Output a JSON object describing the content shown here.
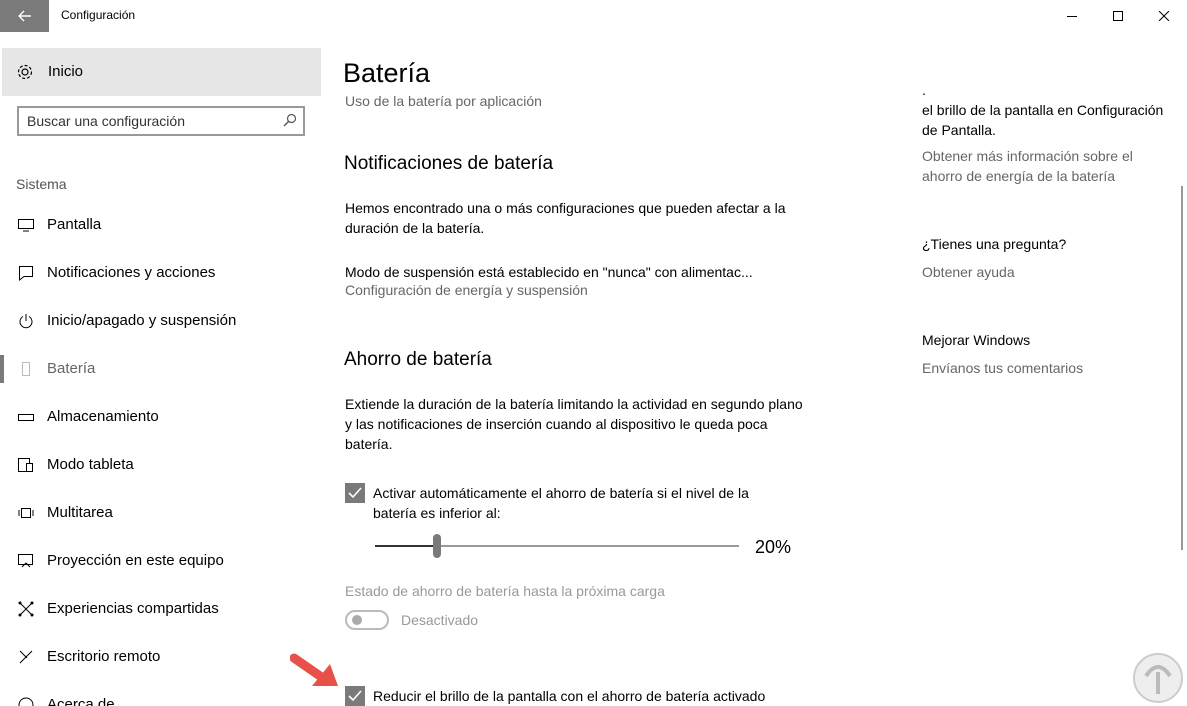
{
  "window": {
    "title": "Configuración",
    "back_icon": "back-arrow-icon",
    "minimize_icon": "minimize-icon",
    "maximize_icon": "maximize-icon",
    "close_icon": "close-icon"
  },
  "sidebar": {
    "home_label": "Inicio",
    "search_placeholder": "Buscar una configuración",
    "section_label": "Sistema",
    "items": [
      {
        "label": "Pantalla",
        "icon": "monitor-icon"
      },
      {
        "label": "Notificaciones y acciones",
        "icon": "notification-icon"
      },
      {
        "label": "Inicio/apagado y suspensión",
        "icon": "power-icon"
      },
      {
        "label": "Batería",
        "icon": "battery-icon",
        "active": true
      },
      {
        "label": "Almacenamiento",
        "icon": "storage-icon"
      },
      {
        "label": "Modo tableta",
        "icon": "tablet-icon"
      },
      {
        "label": "Multitarea",
        "icon": "multitask-icon"
      },
      {
        "label": "Proyección en este equipo",
        "icon": "projection-icon"
      },
      {
        "label": "Experiencias compartidas",
        "icon": "shared-icon"
      },
      {
        "label": "Escritorio remoto",
        "icon": "remote-icon"
      },
      {
        "label": "Acerca de",
        "icon": "info-icon"
      }
    ]
  },
  "main": {
    "title": "Batería",
    "usage_link": "Uso de la batería por aplicación",
    "notifications": {
      "heading": "Notificaciones de batería",
      "text": "Hemos encontrado una o más configuraciones que pueden afectar a la duración de la batería.",
      "sleep_text": "Modo de suspensión está establecido en \"nunca\" con alimentac...",
      "power_link": "Configuración de energía y suspensión"
    },
    "saver": {
      "heading": "Ahorro de batería",
      "description": "Extiende la duración de la batería limitando la actividad en segundo plano y las notificaciones de inserción cuando al dispositivo le queda poca batería.",
      "auto_checkbox_label": "Activar automáticamente el ahorro de batería si el nivel de la batería es inferior al:",
      "auto_checked": true,
      "slider_value_text": "20%",
      "slider_fraction": 0.17,
      "status_label": "Estado de ahorro de batería hasta la próxima carga",
      "toggle_label": "Desactivado",
      "brightness_checkbox_label": "Reducir el brillo de la pantalla con el ahorro de batería activado",
      "brightness_checked": true
    }
  },
  "right_panel": {
    "partial_text": "el brillo de la pantalla en Configuración de Pantalla.",
    "info_link": "Obtener más información sobre el ahorro de energía de la batería",
    "question_heading": "¿Tienes una pregunta?",
    "help_link": "Obtener ayuda",
    "improve_heading": "Mejorar Windows",
    "feedback_link": "Envíanos tus comentarios"
  },
  "colors": {
    "accent_gray": "#7a7a7a",
    "muted_text": "#666666",
    "annotation_red": "#e8504a"
  }
}
